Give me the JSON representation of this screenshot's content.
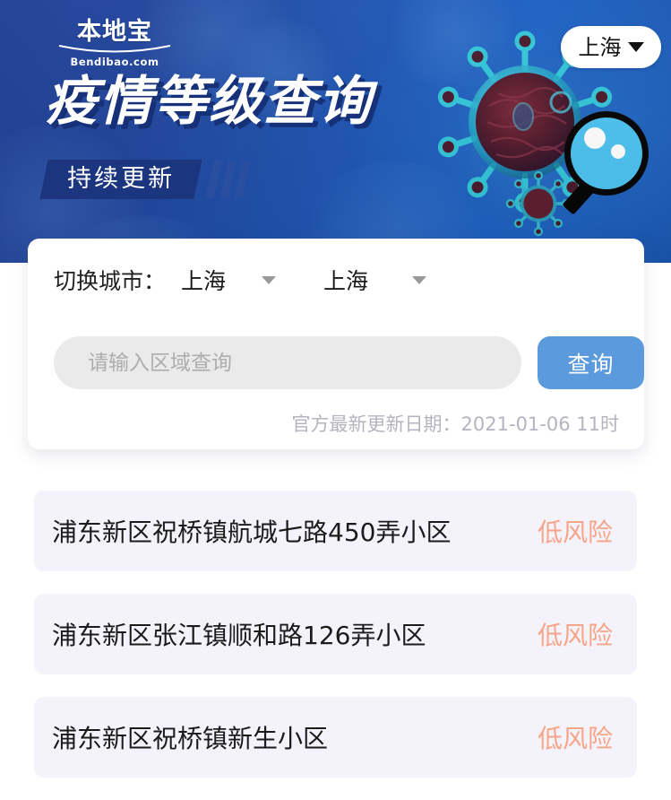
{
  "banner": {
    "logo_cn": "本地宝",
    "logo_en": "Bendibao.com",
    "city_pill": "上海",
    "headline": "疫情等级查询",
    "subtitle": "持续更新",
    "colors": {
      "banner_blue_dark": "#1f3f96",
      "banner_blue_light": "#1a60c4",
      "badge_navy": "#1b357f",
      "magnifier_lens": "#4cc3f0"
    }
  },
  "search_card": {
    "switch_city_label": "切换城市：",
    "province_value": "上海",
    "city_value": "上海",
    "search_placeholder": "请输入区域查询",
    "search_value": "",
    "query_button": "查询",
    "update_date": "官方最新更新日期：2021-01-06 11时",
    "colors": {
      "query_button": "#5b9bdd",
      "input_bg": "#eaeaea",
      "update_text": "#b4b4c0"
    }
  },
  "results": {
    "risk_color": "#f7a588",
    "row_bg": "#f4f2fa",
    "items": [
      {
        "name": "浦东新区祝桥镇航城七路450弄小区",
        "risk": "低风险"
      },
      {
        "name": "浦东新区张江镇顺和路126弄小区",
        "risk": "低风险"
      },
      {
        "name": "浦东新区祝桥镇新生小区",
        "risk": "低风险"
      }
    ]
  }
}
